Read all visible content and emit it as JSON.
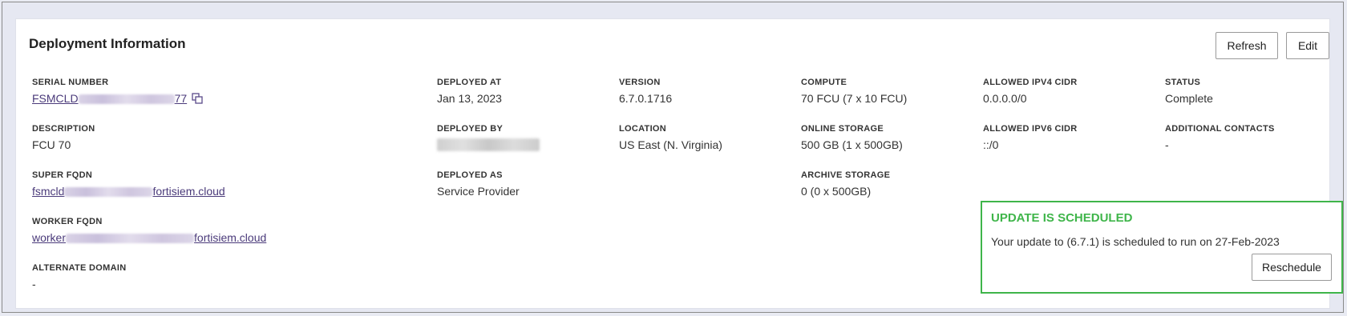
{
  "panel": {
    "title": "Deployment Information",
    "refresh_label": "Refresh",
    "edit_label": "Edit"
  },
  "fields": {
    "serial_number": {
      "label": "SERIAL NUMBER",
      "prefix": "FSMCLD",
      "suffix": "77"
    },
    "deployed_at": {
      "label": "DEPLOYED AT",
      "value": "Jan 13, 2023"
    },
    "version": {
      "label": "VERSION",
      "value": "6.7.0.1716"
    },
    "compute": {
      "label": "COMPUTE",
      "value": "70 FCU (7 x 10 FCU)"
    },
    "allowed_ipv4": {
      "label": "ALLOWED IPV4 CIDR",
      "value": "0.0.0.0/0"
    },
    "status": {
      "label": "STATUS",
      "value": "Complete"
    },
    "description": {
      "label": "DESCRIPTION",
      "value": "FCU 70"
    },
    "deployed_by": {
      "label": "DEPLOYED BY"
    },
    "location": {
      "label": "LOCATION",
      "value": "US East (N. Virginia)"
    },
    "online_storage": {
      "label": "ONLINE STORAGE",
      "value": "500 GB (1 x 500GB)"
    },
    "allowed_ipv6": {
      "label": "ALLOWED IPV6 CIDR",
      "value": "::/0"
    },
    "additional_contacts": {
      "label": "ADDITIONAL CONTACTS",
      "value": "-"
    },
    "super_fqdn": {
      "label": "SUPER FQDN",
      "prefix": "fsmcld",
      "suffix": "fortisiem.cloud"
    },
    "deployed_as": {
      "label": "DEPLOYED AS",
      "value": "Service Provider"
    },
    "archive_storage": {
      "label": "ARCHIVE STORAGE",
      "value": "0 (0 x 500GB)"
    },
    "worker_fqdn": {
      "label": "WORKER FQDN",
      "prefix": "worker",
      "suffix": "fortisiem.cloud"
    },
    "alternate_domain": {
      "label": "ALTERNATE DOMAIN",
      "value": "-"
    }
  },
  "update": {
    "title": "UPDATE IS SCHEDULED",
    "message": "Your update to (6.7.1) is scheduled to run on 27-Feb-2023",
    "reschedule_label": "Reschedule"
  },
  "colors": {
    "success": "#3fb54a",
    "link": "#4a3a7a"
  },
  "icons": {
    "copy": "copy-icon"
  }
}
